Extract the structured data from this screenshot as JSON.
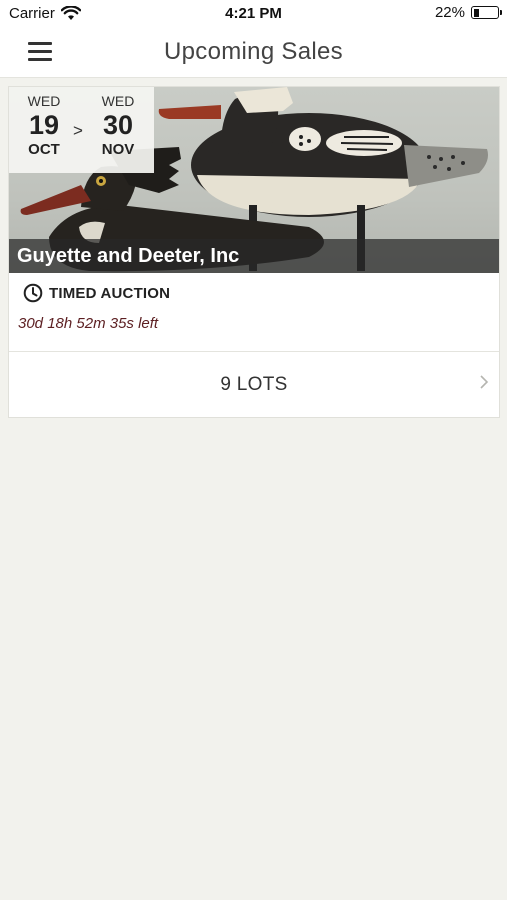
{
  "status_bar": {
    "carrier": "Carrier",
    "time": "4:21 PM",
    "battery": "22%",
    "battery_level": 0.22,
    "icons": [
      "wifi-icon",
      "battery-icon"
    ]
  },
  "nav": {
    "title": "Upcoming Sales",
    "menu_icon": "hamburger-menu-icon"
  },
  "sales": [
    {
      "start": {
        "dow": "WED",
        "day": "19",
        "month": "OCT"
      },
      "separator": ">",
      "end": {
        "dow": "WED",
        "day": "30",
        "month": "NOV"
      },
      "title": "Guyette and Deeter, Inc",
      "type_icon": "clock-icon",
      "type": "TIMED AUCTION",
      "time_left": "30d 18h 52m 35s left",
      "lots": "9 LOTS",
      "lots_icon": "chevron-right-icon",
      "image": "merganser decoys photo"
    }
  ],
  "colors": {
    "background": "#f2f2ed",
    "card": "#ffffff",
    "time_left": "#5c1f22",
    "title_overlay": "#282828"
  }
}
